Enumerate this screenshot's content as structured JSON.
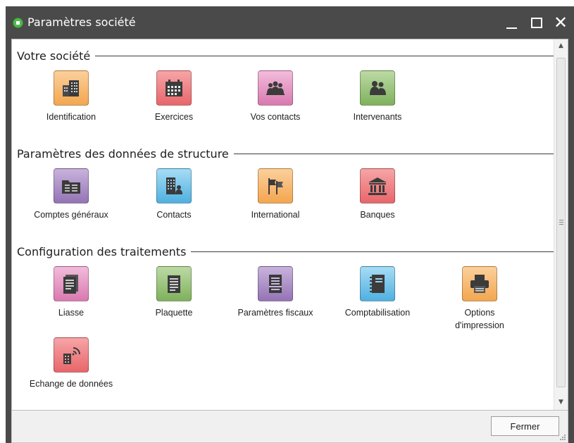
{
  "window": {
    "title": "Paramètres société",
    "controls": {
      "minimize": "_",
      "close": "✕"
    }
  },
  "sections": [
    {
      "title": "Votre société",
      "items": [
        {
          "label": "Identification",
          "icon": "building-icon",
          "color": "#f7b96a"
        },
        {
          "label": "Exercices",
          "icon": "calendar-icon",
          "color": "#ee7e80"
        },
        {
          "label": "Vos contacts",
          "icon": "group-icon",
          "color": "#e597c3"
        },
        {
          "label": "Intervenants",
          "icon": "people-icon",
          "color": "#98c17c"
        }
      ]
    },
    {
      "title": "Paramètres des données de structure",
      "items": [
        {
          "label": "Comptes généraux",
          "icon": "ledger-folder-icon",
          "color": "#a98bc4"
        },
        {
          "label": "Contacts",
          "icon": "office-contact-icon",
          "color": "#72c4ea"
        },
        {
          "label": "International",
          "icon": "flags-icon",
          "color": "#f7b96a"
        },
        {
          "label": "Banques",
          "icon": "bank-icon",
          "color": "#ee7e80"
        }
      ]
    },
    {
      "title": "Configuration des traitements",
      "items": [
        {
          "label": "Liasse",
          "icon": "document-stack-icon",
          "color": "#e597c3"
        },
        {
          "label": "Plaquette",
          "icon": "booklet-icon",
          "color": "#98c17c"
        },
        {
          "label": "Paramètres fiscaux",
          "icon": "tax-document-icon",
          "color": "#a98bc4"
        },
        {
          "label": "Comptabilisation",
          "icon": "notebook-icon",
          "color": "#72c4ea"
        },
        {
          "label": "Options d'impression",
          "icon": "printer-icon",
          "color": "#f7b96a"
        },
        {
          "label": "Echange de données",
          "icon": "data-exchange-icon",
          "color": "#ee7e80"
        }
      ]
    }
  ],
  "footer": {
    "close_label": "Fermer"
  }
}
